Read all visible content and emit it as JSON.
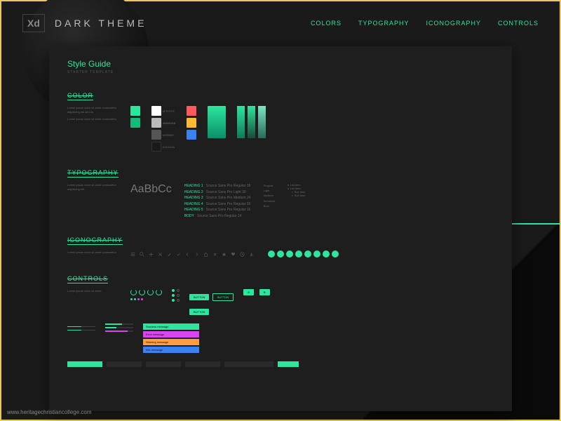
{
  "header": {
    "logo": "Xd",
    "title": "DARK THEME",
    "nav": [
      "COLORS",
      "TYPOGRAPHY",
      "ICONOGRAPHY",
      "CONTROLS"
    ]
  },
  "styleguide": {
    "title": "Style Guide",
    "subtitle": "STARTER TEMPLATE"
  },
  "sections": {
    "color": {
      "heading": "COLOR"
    },
    "typography": {
      "heading": "TYPOGRAPHY",
      "sample": "AaBbCc",
      "h1_label": "HEADING 1",
      "h1_spec": "Source Sans Pro Regular 36",
      "h2_label": "HEADING 2",
      "h2_spec": "Source Sans Pro Light 30",
      "h3_label": "HEADING 3",
      "h3_spec": "Source Sans Pro Medium 24",
      "h4_label": "HEADING 4",
      "h4_spec": "Source Sans Pro Regular 20",
      "h5_label": "HEADING 5",
      "h5_spec": "Source Sans Pro Regular 16",
      "body_label": "BODY",
      "body_spec": "Source Sans Pro Regular 14"
    },
    "iconography": {
      "heading": "ICONOGRAPHY"
    },
    "controls": {
      "heading": "CONTROLS"
    }
  },
  "colors": {
    "primary": [
      "#2ee59d",
      "#19b876"
    ],
    "grays": [
      "#ffffff",
      "#bbbbbb",
      "#888888",
      "#555555",
      "#333333",
      "#1a1a1a"
    ],
    "accents": [
      "#ff5a5a",
      "#ffb938",
      "#3b82f6"
    ],
    "gradient_from": "#2ee59d",
    "gradient_to": "#0a8f69"
  },
  "footer_url": "www.heritagechristiancollege.com"
}
